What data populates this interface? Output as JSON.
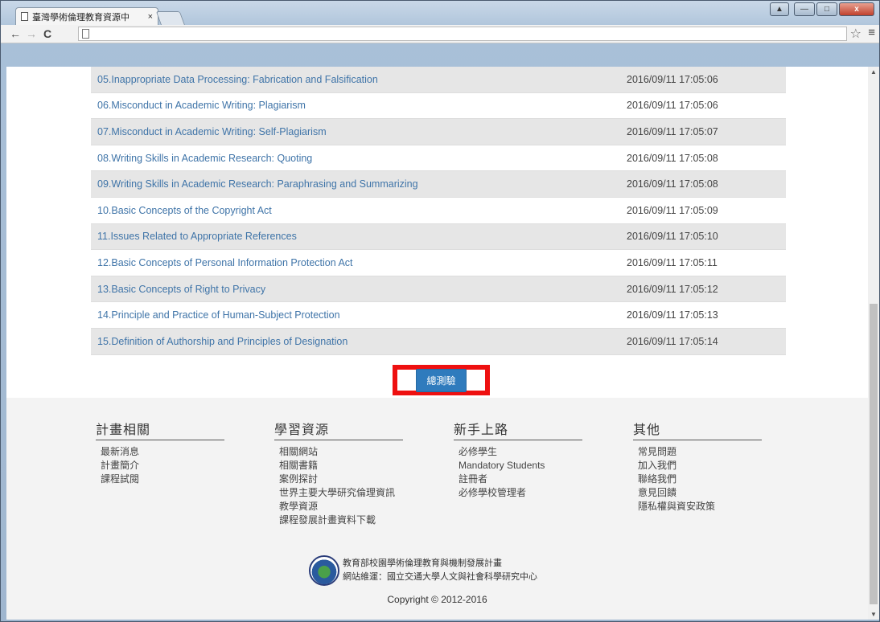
{
  "browser": {
    "tab_title": "臺灣學術倫理教育資源中",
    "tab_close": "×",
    "back": "←",
    "forward": "→",
    "reload": "C",
    "star": "☆",
    "menu": "≡",
    "win_user": "▲",
    "win_min": "—",
    "win_max": "□",
    "win_close": "x"
  },
  "units": [
    {
      "title": "05.Inappropriate Data Processing: Fabrication and Falsification",
      "date": "2016/09/11 17:05:06"
    },
    {
      "title": "06.Misconduct in Academic Writing: Plagiarism",
      "date": "2016/09/11 17:05:06"
    },
    {
      "title": "07.Misconduct in Academic Writing: Self-Plagiarism",
      "date": "2016/09/11 17:05:07"
    },
    {
      "title": "08.Writing Skills in Academic Research: Quoting",
      "date": "2016/09/11 17:05:08"
    },
    {
      "title": "09.Writing Skills in Academic Research: Paraphrasing and Summarizing",
      "date": "2016/09/11 17:05:08"
    },
    {
      "title": "10.Basic Concepts of the Copyright Act",
      "date": "2016/09/11 17:05:09"
    },
    {
      "title": "11.Issues Related to Appropriate References",
      "date": "2016/09/11 17:05:10"
    },
    {
      "title": "12.Basic Concepts of Personal Information Protection Act",
      "date": "2016/09/11 17:05:11"
    },
    {
      "title": "13.Basic Concepts of Right to Privacy",
      "date": "2016/09/11 17:05:12"
    },
    {
      "title": "14.Principle and Practice of Human-Subject Protection",
      "date": "2016/09/11 17:05:13"
    },
    {
      "title": "15.Definition of Authorship and Principles of Designation",
      "date": "2016/09/11 17:05:14"
    }
  ],
  "exam_button": "總測驗",
  "footer": {
    "columns": [
      {
        "heading": "計畫相關",
        "items": [
          "最新消息",
          "計畫簡介",
          "課程試閱"
        ]
      },
      {
        "heading": "學習資源",
        "items": [
          "相關網站",
          "相關書籍",
          "案例探討",
          "世界主要大學研究倫理資訊",
          "教學資源",
          "課程發展計畫資料下載"
        ]
      },
      {
        "heading": "新手上路",
        "items": [
          "必修學生",
          "Mandatory Students",
          "註冊者",
          "必修學校管理者"
        ]
      },
      {
        "heading": "其他",
        "items": [
          "常見問題",
          "加入我們",
          "聯絡我們",
          "意見回饋",
          "隱私權與資安政策"
        ]
      }
    ],
    "credit_line1": "教育部校園學術倫理教育與機制發展計畫",
    "credit_line2": "網站維運：國立交通大學人文與社會科學研究中心",
    "copyright": "Copyright © 2012-2016"
  }
}
